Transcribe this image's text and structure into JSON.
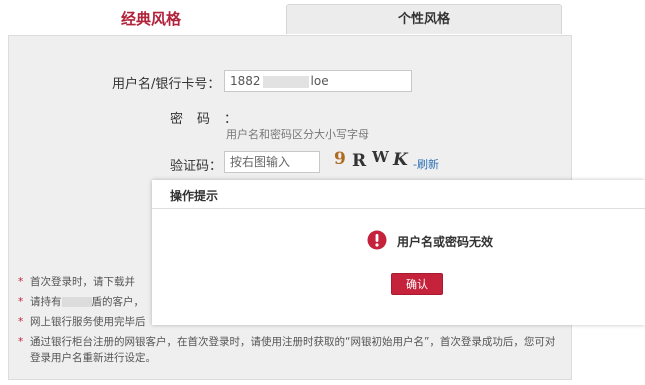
{
  "tabs": {
    "classic": "经典风格",
    "personal": "个性风格"
  },
  "form": {
    "username_label": "用户名/银行卡号：",
    "username_prefix": "1882",
    "username_suffix": "loe",
    "password_label": "密码：",
    "hint": "用户名和密码区分大小写字母",
    "captcha_label": "验证码：",
    "captcha_placeholder": "按右图输入",
    "captcha_chars": [
      "9",
      "R",
      "W",
      "K"
    ],
    "refresh_link": "刷新"
  },
  "notes": {
    "star": "*",
    "n1": "首次登录时，请下载并",
    "n2_pre": "请持有",
    "n2_post": "盾的客户，",
    "n3": "网上银行服务使用完毕后",
    "n4": "通过银行柜台注册的网银客户，在首次登录时，请使用注册时获取的“网银初始用户名”，首次登录成功后，您可对登录用户名重新进行设定。"
  },
  "dialog": {
    "title": "操作提示",
    "message": "用户名或密码无效",
    "ok_button": "确认"
  },
  "colors": {
    "brand_red": "#c4233b",
    "link_blue": "#2a6fb5"
  }
}
